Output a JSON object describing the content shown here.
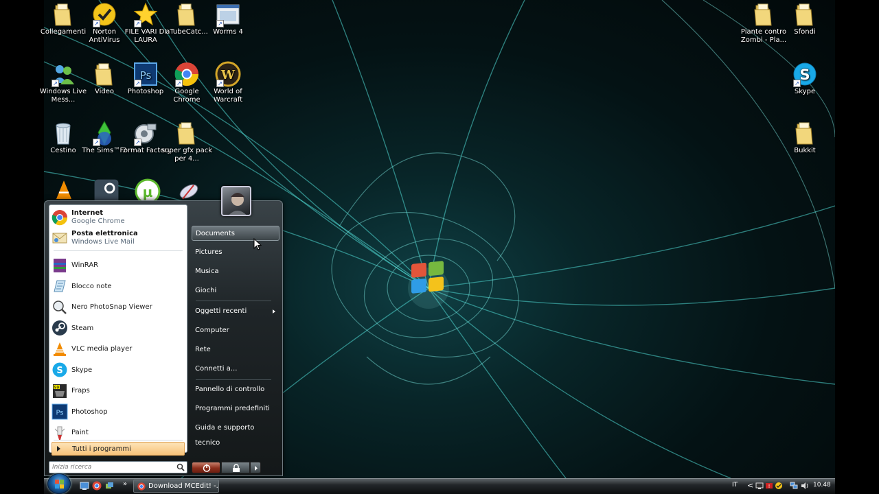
{
  "desktop": {
    "icons": [
      {
        "label": "Collegamenti",
        "icon": "folder-icon"
      },
      {
        "label": "Norton AntiVirus",
        "icon": "norton-icon"
      },
      {
        "label": "FILE VARI DI LAURA",
        "icon": "star-icon"
      },
      {
        "label": "aTubeCatc...",
        "icon": "folder-icon"
      },
      {
        "label": "Worms 4",
        "icon": "worms-icon"
      },
      {
        "label": "Windows Live Mess...",
        "icon": "messenger-icon"
      },
      {
        "label": "Video",
        "icon": "folder-icon"
      },
      {
        "label": "Photoshop",
        "icon": "photoshop-icon"
      },
      {
        "label": "Google Chrome",
        "icon": "chrome-icon"
      },
      {
        "label": "World of Warcraft",
        "icon": "warcraft-icon"
      },
      {
        "label": "Cestino",
        "icon": "recycle-bin-icon"
      },
      {
        "label": "The Sims™ 2",
        "icon": "sims-icon"
      },
      {
        "label": "Format Factory",
        "icon": "format-factory-icon"
      },
      {
        "label": "super gfx pack per 4...",
        "icon": "folder-icon"
      },
      {
        "label": "Piante contro Zombi - Pla...",
        "icon": "folder-icon"
      },
      {
        "label": "Sfondi",
        "icon": "folder-icon"
      },
      {
        "label": "Skype",
        "icon": "skype-icon"
      },
      {
        "label": "Bukkit",
        "icon": "folder-icon"
      }
    ]
  },
  "start_menu": {
    "pinned": [
      {
        "title": "Internet",
        "subtitle": "Google Chrome",
        "icon": "chrome-icon"
      },
      {
        "title": "Posta elettronica",
        "subtitle": "Windows Live Mail",
        "icon": "mail-icon"
      }
    ],
    "recent": [
      {
        "label": "WinRAR",
        "icon": "winrar-icon"
      },
      {
        "label": "Blocco note",
        "icon": "notepad-icon"
      },
      {
        "label": "Nero PhotoSnap Viewer",
        "icon": "nero-icon"
      },
      {
        "label": "Steam",
        "icon": "steam-icon"
      },
      {
        "label": "VLC media player",
        "icon": "vlc-icon"
      },
      {
        "label": "Skype",
        "icon": "skype-icon"
      },
      {
        "label": "Fraps",
        "icon": "fraps-icon"
      },
      {
        "label": "Photoshop",
        "icon": "photoshop-icon"
      },
      {
        "label": "Paint",
        "icon": "paint-icon"
      }
    ],
    "all_programs": "Tutti i programmi",
    "search_placeholder": "Inizia ricerca",
    "right_items": [
      {
        "label": "Documents",
        "highlighted": true
      },
      {
        "label": "Pictures"
      },
      {
        "label": "Musica"
      },
      {
        "label": "Giochi"
      },
      {
        "label": "Oggetti recenti",
        "submenu": true
      },
      {
        "label": "Computer"
      },
      {
        "label": "Rete"
      },
      {
        "label": "Connetti a..."
      },
      {
        "label": "Pannello di controllo"
      },
      {
        "label": "Programmi predefiniti"
      },
      {
        "label": "Guida e supporto tecnico"
      }
    ]
  },
  "taskbar": {
    "window_button": "Download MCEdit! -...",
    "language": "IT",
    "clock": "10.48",
    "tray_expand": "<",
    "quick_launch_overflow": "»"
  },
  "colors": {
    "accent_teal": "#4fd6d0",
    "menu_hover": "#f8c37a",
    "orb_blue": "#1b5fa3"
  }
}
